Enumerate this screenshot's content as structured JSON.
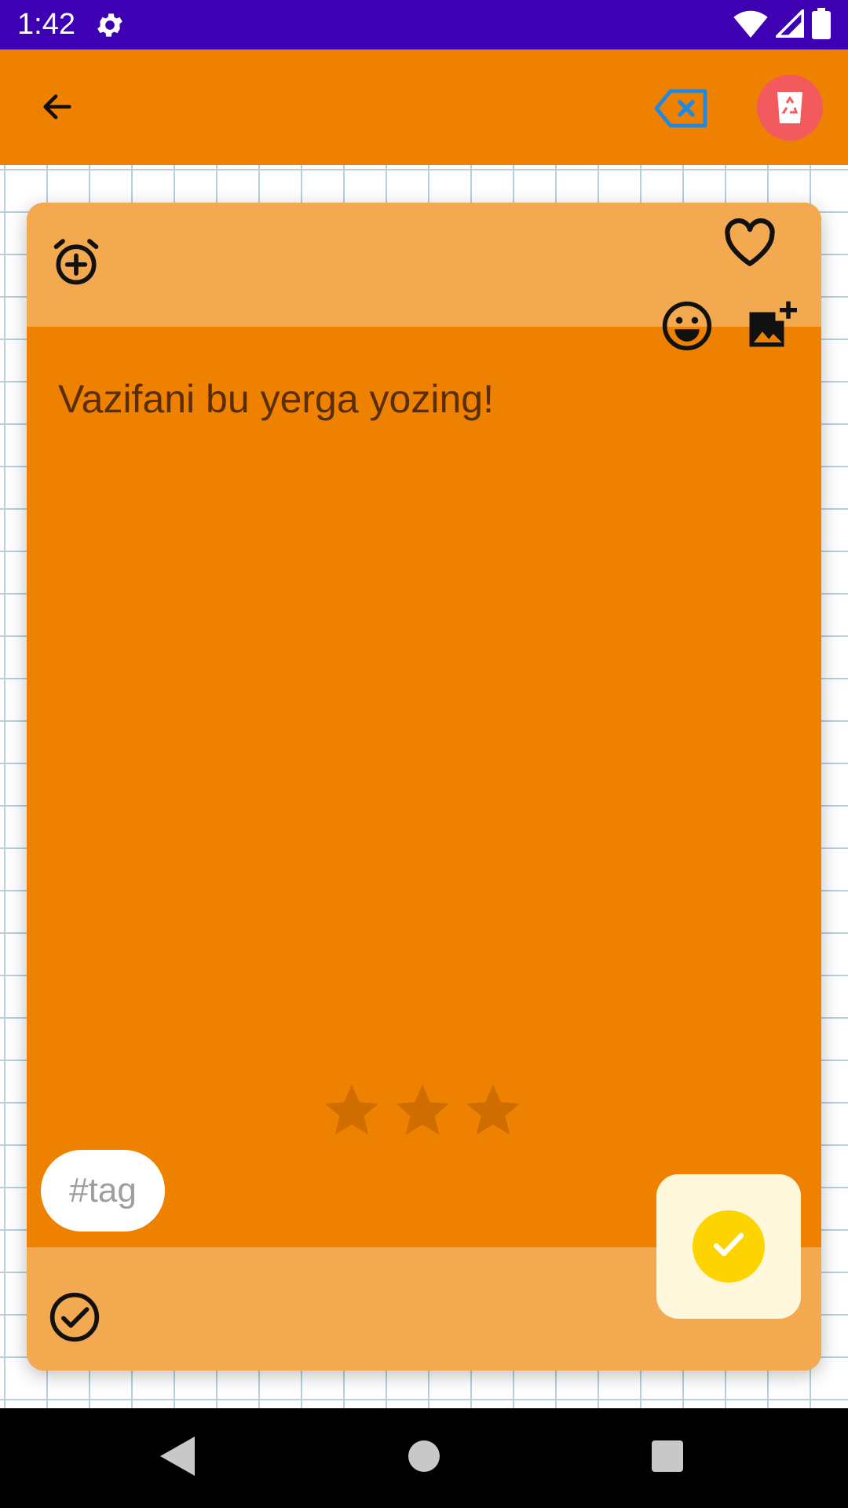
{
  "status_bar": {
    "time": "1:42",
    "icons": [
      "settings-icon",
      "wifi-icon",
      "signal-icon",
      "battery-icon"
    ]
  },
  "app_bar": {
    "icons": [
      "back-arrow-icon",
      "clear-text-icon",
      "recycle-bin-icon"
    ],
    "colors": {
      "background": "#ef8100",
      "delete_button": "#f25a5e",
      "clear_icon": "#1e88e5"
    }
  },
  "note_card": {
    "icons": [
      "alarm-add-icon",
      "heart-outline-icon",
      "smiley-icon",
      "add-photo-icon",
      "check-circle-outline-icon"
    ],
    "text": "Vazifani bu yerga yozing!",
    "rating": {
      "max": 3,
      "value": 0
    },
    "tag": "#tag",
    "colors": {
      "body": "#ef8100",
      "header_footer": "#f2a94f"
    }
  },
  "save_button": {
    "icon": "checkmark-icon",
    "colors": {
      "box": "#fff8dc",
      "circle": "#fdd300"
    }
  },
  "nav_bar": {
    "icons": [
      "back-triangle-icon",
      "home-circle-icon",
      "recents-square-icon"
    ]
  }
}
